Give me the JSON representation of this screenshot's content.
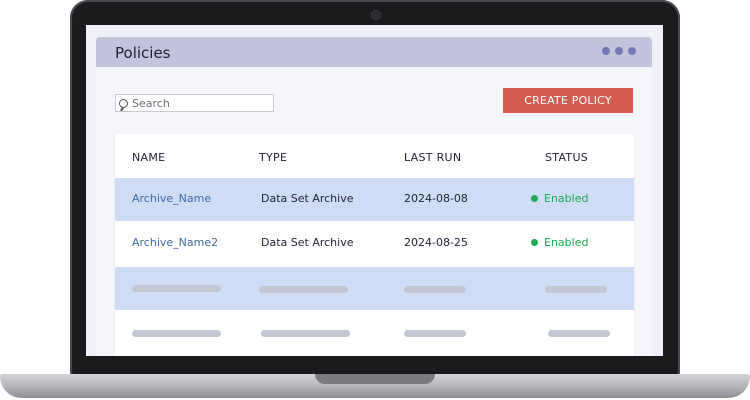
{
  "app": {
    "title": "Policies"
  },
  "search": {
    "placeholder": "Search"
  },
  "toolbar": {
    "create_label": "CREATE POLICY"
  },
  "table": {
    "columns": [
      "NAME",
      "TYPE",
      "LAST RUN",
      "STATUS"
    ],
    "rows": [
      {
        "name": "Archive_Name",
        "type": "Data Set Archive",
        "last_run": "2024-08-08",
        "status": "Enabled"
      },
      {
        "name": "Archive_Name2",
        "type": "Data Set Archive",
        "last_run": "2024-08-25",
        "status": "Enabled"
      }
    ]
  },
  "colors": {
    "header_bar": "#c2c4dc",
    "accent_dots": "#7479b4",
    "create_button": "#d55c51",
    "row_highlight": "#cfdcf6",
    "name_link": "#3d6ba6",
    "status_enabled": "#1eaa53"
  }
}
